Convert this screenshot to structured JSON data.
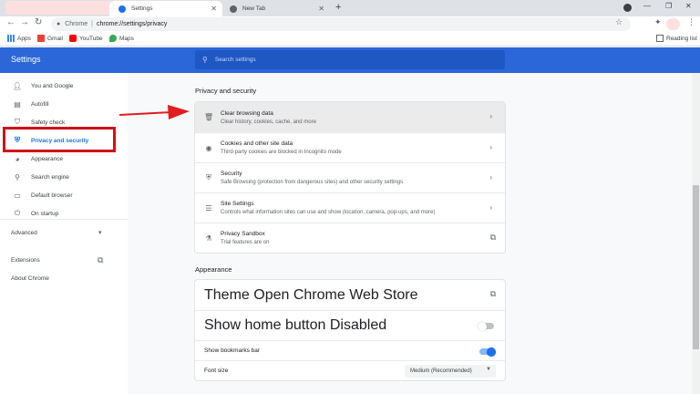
{
  "tabs": [
    {
      "label": "Settings",
      "active": true
    },
    {
      "label": "New Tab",
      "active": false
    }
  ],
  "omnibox": {
    "host": "Chrome",
    "separator": "|",
    "url": "chrome://settings/privacy"
  },
  "bookmarks": [
    {
      "label": "Apps",
      "icon": "apps-grid-icon"
    },
    {
      "label": "Gmail",
      "icon": "gmail-icon"
    },
    {
      "label": "YouTube",
      "icon": "youtube-icon"
    },
    {
      "label": "Maps",
      "icon": "maps-icon"
    }
  ],
  "reading_list": "Reading list",
  "header": {
    "title": "Settings",
    "search_placeholder": "Search settings"
  },
  "sidebar": {
    "items": [
      {
        "label": "You and Google",
        "icon": "person-icon"
      },
      {
        "label": "Autofill",
        "icon": "clipboard-icon"
      },
      {
        "label": "Safety check",
        "icon": "shield-check-icon"
      },
      {
        "label": "Privacy and security",
        "icon": "shield-icon",
        "active": true
      },
      {
        "label": "Appearance",
        "icon": "palette-icon"
      },
      {
        "label": "Search engine",
        "icon": "search-icon"
      },
      {
        "label": "Default browser",
        "icon": "browser-icon"
      },
      {
        "label": "On startup",
        "icon": "power-icon"
      }
    ],
    "advanced": "Advanced",
    "extensions": "Extensions",
    "about": "About Chrome"
  },
  "privacy": {
    "title": "Privacy and security",
    "rows": [
      {
        "title": "Clear browsing data",
        "sub": "Clear history, cookies, cache, and more",
        "icon": "trash-icon"
      },
      {
        "title": "Cookies and other site data",
        "sub": "Third-party cookies are blocked in Incognito mode",
        "icon": "cookie-icon"
      },
      {
        "title": "Security",
        "sub": "Safe Browsing (protection from dangerous sites) and other security settings",
        "icon": "shield-icon"
      },
      {
        "title": "Site Settings",
        "sub": "Controls what information sites can use and show (location, camera, pop-ups, and more)",
        "icon": "sliders-icon"
      },
      {
        "title": "Privacy Sandbox",
        "sub": "Trial features are on",
        "icon": "flask-icon"
      }
    ]
  },
  "appearance": {
    "title": "Appearance",
    "theme": {
      "title": "Theme",
      "sub": "Open Chrome Web Store"
    },
    "home_button": {
      "title": "Show home button",
      "sub": "Disabled",
      "on": false
    },
    "bookmarks_bar": {
      "title": "Show bookmarks bar",
      "on": true
    },
    "font_size": {
      "title": "Font size",
      "value": "Medium (Recommended)"
    }
  },
  "colors": {
    "accent": "#1a73e8",
    "header": "#2b67d9",
    "highlight_box": "#d0101b"
  }
}
